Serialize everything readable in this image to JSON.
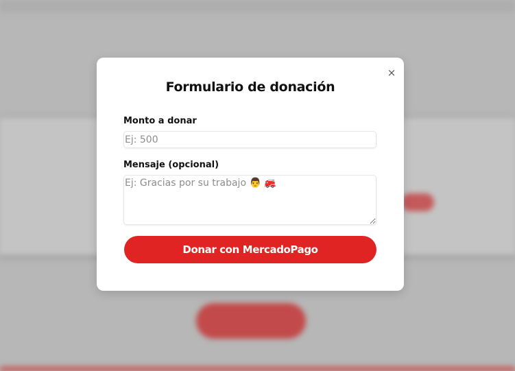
{
  "modal": {
    "title": "Formulario de donación",
    "close_label": "×",
    "amount_label": "Monto a donar",
    "amount_placeholder": "Ej: 500",
    "amount_value": "",
    "message_label": "Mensaje (opcional)",
    "message_placeholder": "Ej: Gracias por su trabajo 👨 🚒",
    "message_value": "",
    "submit_label": "Donar con MercadoPago"
  },
  "colors": {
    "accent": "#e02424",
    "overlay": "#b7b7b7",
    "modal_bg": "#ffffff"
  },
  "icons": {
    "close": "close-icon"
  }
}
